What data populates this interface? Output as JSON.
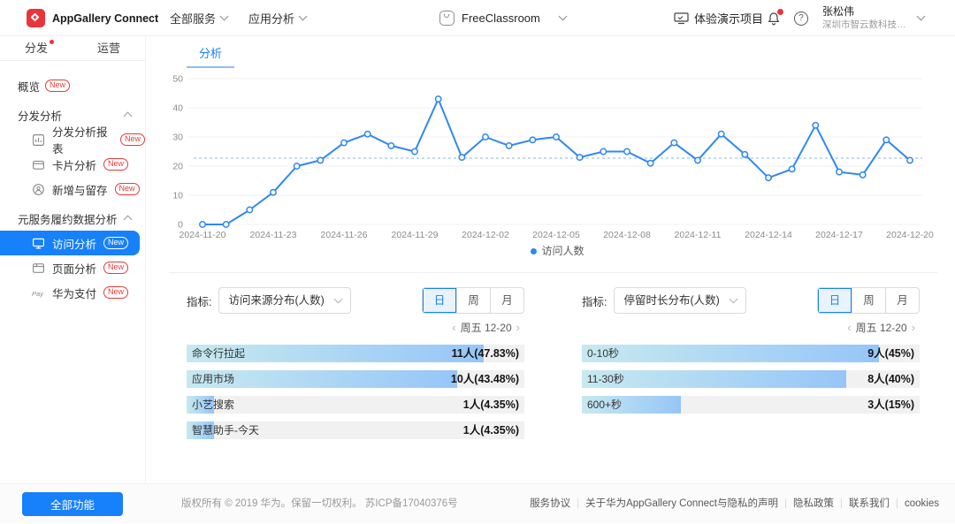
{
  "header": {
    "logo_text": "AppGallery Connect",
    "menu_all_services": "全部服务",
    "menu_app_analysis": "应用分析",
    "app_selector_value": "FreeClassroom",
    "demo_project_label": "体验演示项目",
    "user_name": "张松伟",
    "user_company": "深圳市智云数科技术有限..."
  },
  "sidebar": {
    "tab_distribution": "分发",
    "tab_operation": "运营",
    "items": [
      {
        "key": "overview",
        "type": "link",
        "label": "概览",
        "badge": "New"
      },
      {
        "key": "distribution-analysis-group",
        "type": "group",
        "label": "分发分析"
      },
      {
        "key": "distribution-report",
        "type": "sub",
        "icon": "report-icon",
        "label": "分发分析报表",
        "badge": "New"
      },
      {
        "key": "card-analysis",
        "type": "sub",
        "icon": "card-icon",
        "label": "卡片分析",
        "badge": "New"
      },
      {
        "key": "new-and-retention",
        "type": "sub",
        "icon": "retention-icon",
        "label": "新增与留存",
        "badge": "New"
      },
      {
        "key": "atomic-service-group",
        "type": "group",
        "label": "元服务履约数据分析"
      },
      {
        "key": "access-analysis",
        "type": "sub",
        "icon": "monitor-icon",
        "label": "访问分析",
        "badge": "New",
        "selected": true
      },
      {
        "key": "page-analysis",
        "type": "sub",
        "icon": "page-icon",
        "label": "页面分析",
        "badge": "New"
      },
      {
        "key": "huawei-pay",
        "type": "sub",
        "icon": "pay-icon",
        "label": "华为支付",
        "badge": "New"
      }
    ]
  },
  "main": {
    "tab_label": "分析",
    "metric_label": "指标:",
    "panels": [
      {
        "metric_value": "访问来源分布(人数)",
        "tabs": [
          "日",
          "周",
          "月"
        ],
        "active_tab": "日",
        "date_nav": "周五 12-20",
        "prev_arrow": "‹",
        "next_arrow": "›",
        "bars": [
          {
            "label": "命令行拉起",
            "value": 11,
            "value_text": "11人(47.83%)"
          },
          {
            "label": "应用市场",
            "value": 10,
            "value_text": "10人(43.48%)"
          },
          {
            "label": "小艺搜索",
            "value": 1,
            "value_text": "1人(4.35%)"
          },
          {
            "label": "智慧助手-今天",
            "value": 1,
            "value_text": "1人(4.35%)"
          }
        ]
      },
      {
        "metric_value": "停留时长分布(人数)",
        "tabs": [
          "日",
          "周",
          "月"
        ],
        "active_tab": "日",
        "date_nav": "周五 12-20",
        "prev_arrow": "‹",
        "next_arrow": "›",
        "bars": [
          {
            "label": "0-10秒",
            "value": 9,
            "value_text": "9人(45%)"
          },
          {
            "label": "11-30秒",
            "value": 8,
            "value_text": "8人(40%)"
          },
          {
            "label": "600+秒",
            "value": 3,
            "value_text": "3人(15%)"
          }
        ]
      }
    ]
  },
  "chart_data": {
    "type": "line",
    "title": "",
    "xlabel": "",
    "ylabel": "",
    "ylim": [
      0,
      50
    ],
    "y_ticks": [
      0,
      10,
      20,
      30,
      40,
      50
    ],
    "grid": true,
    "mean_line": true,
    "legend_position": "bottom-center",
    "line_color": "#2f87f5",
    "x": [
      "2024-11-20",
      "2024-11-21",
      "2024-11-22",
      "2024-11-23",
      "2024-11-24",
      "2024-11-25",
      "2024-11-26",
      "2024-11-27",
      "2024-11-28",
      "2024-11-29",
      "2024-11-30",
      "2024-12-01",
      "2024-12-02",
      "2024-12-03",
      "2024-12-04",
      "2024-12-05",
      "2024-12-06",
      "2024-12-07",
      "2024-12-08",
      "2024-12-09",
      "2024-12-10",
      "2024-12-11",
      "2024-12-12",
      "2024-12-13",
      "2024-12-14",
      "2024-12-15",
      "2024-12-16",
      "2024-12-17",
      "2024-12-18",
      "2024-12-19",
      "2024-12-20"
    ],
    "x_tick_labels": [
      "2024-11-20",
      "2024-11-23",
      "2024-11-26",
      "2024-11-29",
      "2024-12-02",
      "2024-12-05",
      "2024-12-08",
      "2024-12-11",
      "2024-12-14",
      "2024-12-17",
      "2024-12-20"
    ],
    "series": [
      {
        "name": "访问人数",
        "values": [
          0,
          0,
          5,
          11,
          20,
          22,
          28,
          31,
          27,
          25,
          43,
          23,
          30,
          27,
          29,
          30,
          23,
          25,
          25,
          21,
          28,
          22,
          31,
          24,
          16,
          19,
          34,
          18,
          17,
          29,
          22
        ]
      }
    ]
  },
  "footer": {
    "all_features_button": "全部功能",
    "copyright": "版权所有 © 2019 华为。保留一切权利。 苏ICP备17040376号",
    "links": [
      "服务协议",
      "关于华为AppGallery Connect与隐私的声明",
      "隐私政策",
      "联系我们",
      "cookies"
    ]
  },
  "colors": {
    "accent_blue": "#1780fb",
    "line_blue": "#2f87f5",
    "badge_red": "#e23c39",
    "logo_red": "#e8353b",
    "bar_fill_start": "#c7e9ef",
    "bar_fill_end": "#96c5f8"
  }
}
